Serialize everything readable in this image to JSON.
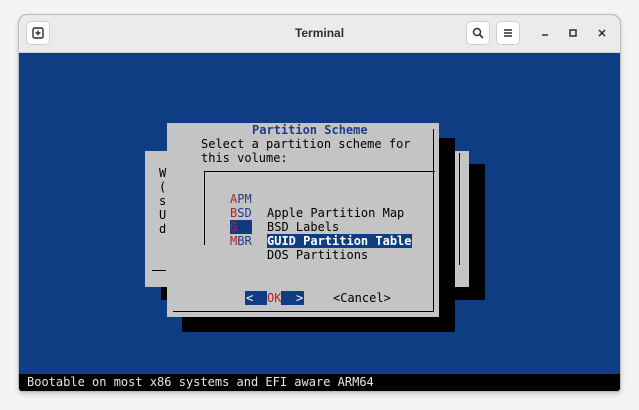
{
  "window": {
    "title": "Terminal"
  },
  "dialog": {
    "title": "Partition Scheme",
    "prompt_line1": "Select a partition scheme for",
    "prompt_line2": "this volume:",
    "items": [
      {
        "key_first": "A",
        "key_rest": "PM",
        "label": "Apple Partition Map",
        "selected": false
      },
      {
        "key_first": "B",
        "key_rest": "SD",
        "label": "BSD Labels",
        "selected": false
      },
      {
        "key_first": "G",
        "key_rest": "PT",
        "label": "GUID Partition Table",
        "selected": true
      },
      {
        "key_first": "M",
        "key_rest": "BR",
        "label": "DOS Partitions",
        "selected": false
      }
    ],
    "ok_lt": "<",
    "ok_label": "OK",
    "ok_gt": ">",
    "cancel_label": "<Cancel>"
  },
  "background_dialog": {
    "left_chars": [
      "W",
      "(",
      "s",
      "U",
      "d"
    ]
  },
  "statusbar": {
    "text": "Bootable on most x86 systems and EFI aware ARM64"
  },
  "colors": {
    "terminal_bg": "#0e3d83",
    "dialog_bg": "#c4c4c4",
    "hotkey": "#b52020",
    "selection": "#0e3d83"
  }
}
